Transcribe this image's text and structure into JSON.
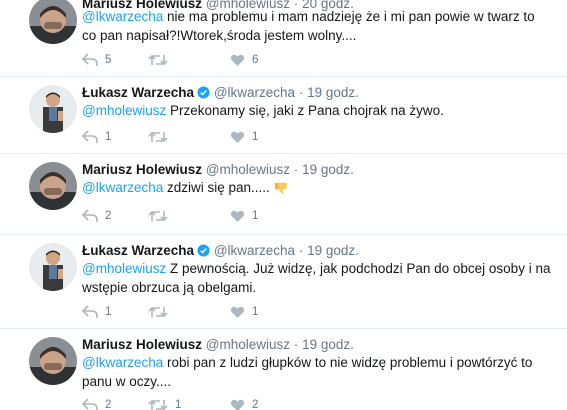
{
  "tweets": [
    {
      "name": "Mariusz Holewiusz",
      "handle": "@mholewiusz",
      "dot": "·",
      "time": "20 godz.",
      "verified": false,
      "mention": "@lkwarzecha",
      "text": " nie ma problemu i mam nadzieję że i mi pan powie w twarz to co pan napisał?!Wtorek,środa jestem wolny....",
      "reply_count": "5",
      "retweet_count": "",
      "like_count": "6"
    },
    {
      "name": "Łukasz Warzecha",
      "handle": "@lkwarzecha",
      "dot": "·",
      "time": "19 godz.",
      "verified": true,
      "mention": "@mholewiusz",
      "text": " Przekonamy się, jaki z Pana chojrak na żywo.",
      "reply_count": "1",
      "retweet_count": "",
      "like_count": "1"
    },
    {
      "name": "Mariusz Holewiusz",
      "handle": "@mholewiusz",
      "dot": "·",
      "time": "19 godz.",
      "verified": false,
      "mention": "@lkwarzecha",
      "text": " zdziwi się pan.....",
      "emoji": "thumbs-down-emoji",
      "reply_count": "2",
      "retweet_count": "",
      "like_count": "1"
    },
    {
      "name": "Łukasz Warzecha",
      "handle": "@lkwarzecha",
      "dot": "·",
      "time": "19 godz.",
      "verified": true,
      "mention": "@mholewiusz",
      "text": " Z pewnością. Już widzę, jak podchodzi Pan do obcej osoby i na wstępie obrzuca ją obelgami.",
      "reply_count": "1",
      "retweet_count": "",
      "like_count": "1"
    },
    {
      "name": "Mariusz Holewiusz",
      "handle": "@mholewiusz",
      "dot": "·",
      "time": "19 godz.",
      "verified": false,
      "mention": "@lkwarzecha",
      "text": " robi pan z ludzi głupków to nie widzę problemu i powtórzyć to panu w oczy....",
      "reply_count": "2",
      "retweet_count": "1",
      "like_count": "2"
    }
  ],
  "icons": {
    "reply": "reply-icon",
    "retweet": "retweet-icon",
    "like": "heart-icon",
    "verified": "verified-badge-icon"
  },
  "colors": {
    "link": "#1da1f2",
    "secondary": "#657786",
    "icon": "#8899a6",
    "divider": "#e1e8ed"
  }
}
